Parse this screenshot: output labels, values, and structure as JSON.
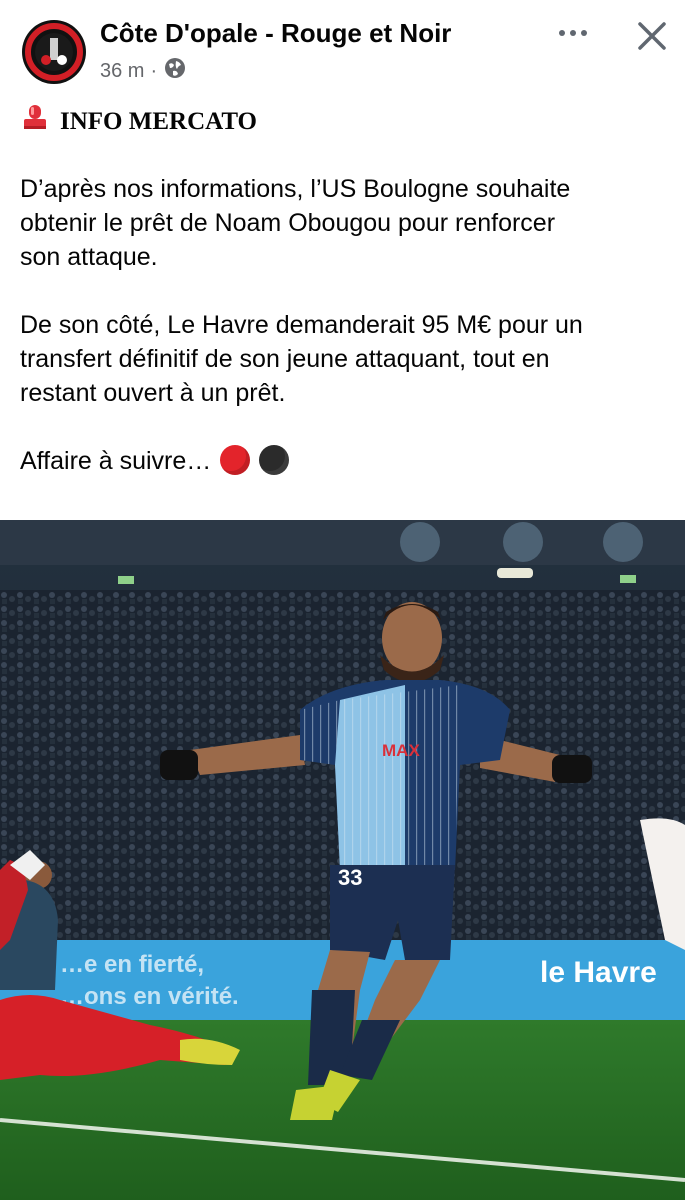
{
  "post": {
    "author": "Côte D'opale - Rouge et Noir",
    "time": "36 m",
    "separator": "·",
    "heading": "INFO MERCATO",
    "paragraph1": [
      "D’après nos informations, l’US Boulogne souhaite",
      "obtenir le prêt de Noam Obougou pour renforcer",
      "son attaque."
    ],
    "paragraph2": [
      "De son côté, Le Havre demanderait 95 M€ pour un",
      "transfert définitif de son jeune attaquant, tout en",
      "restant ouvert à un prêt."
    ],
    "closing": "Affaire à suivre…",
    "photo": {
      "shirt_number": "33",
      "sponsor": "MAX",
      "board_left_line1": "…e en fierté,",
      "board_left_line2": "…ons en vérité.",
      "board_right": "le Havre"
    }
  },
  "icons": {
    "avatar": "club-logo-avatar",
    "privacy": "globe-icon",
    "more": "more-options-icon",
    "close": "close-icon",
    "siren": "siren-emoji",
    "dots": [
      "red-circle-emoji",
      "black-circle-emoji"
    ]
  },
  "colors": {
    "text": "#050505",
    "meta": "#65676b",
    "red_dot": "#e3242b",
    "black_dot": "#2b2b2b"
  }
}
